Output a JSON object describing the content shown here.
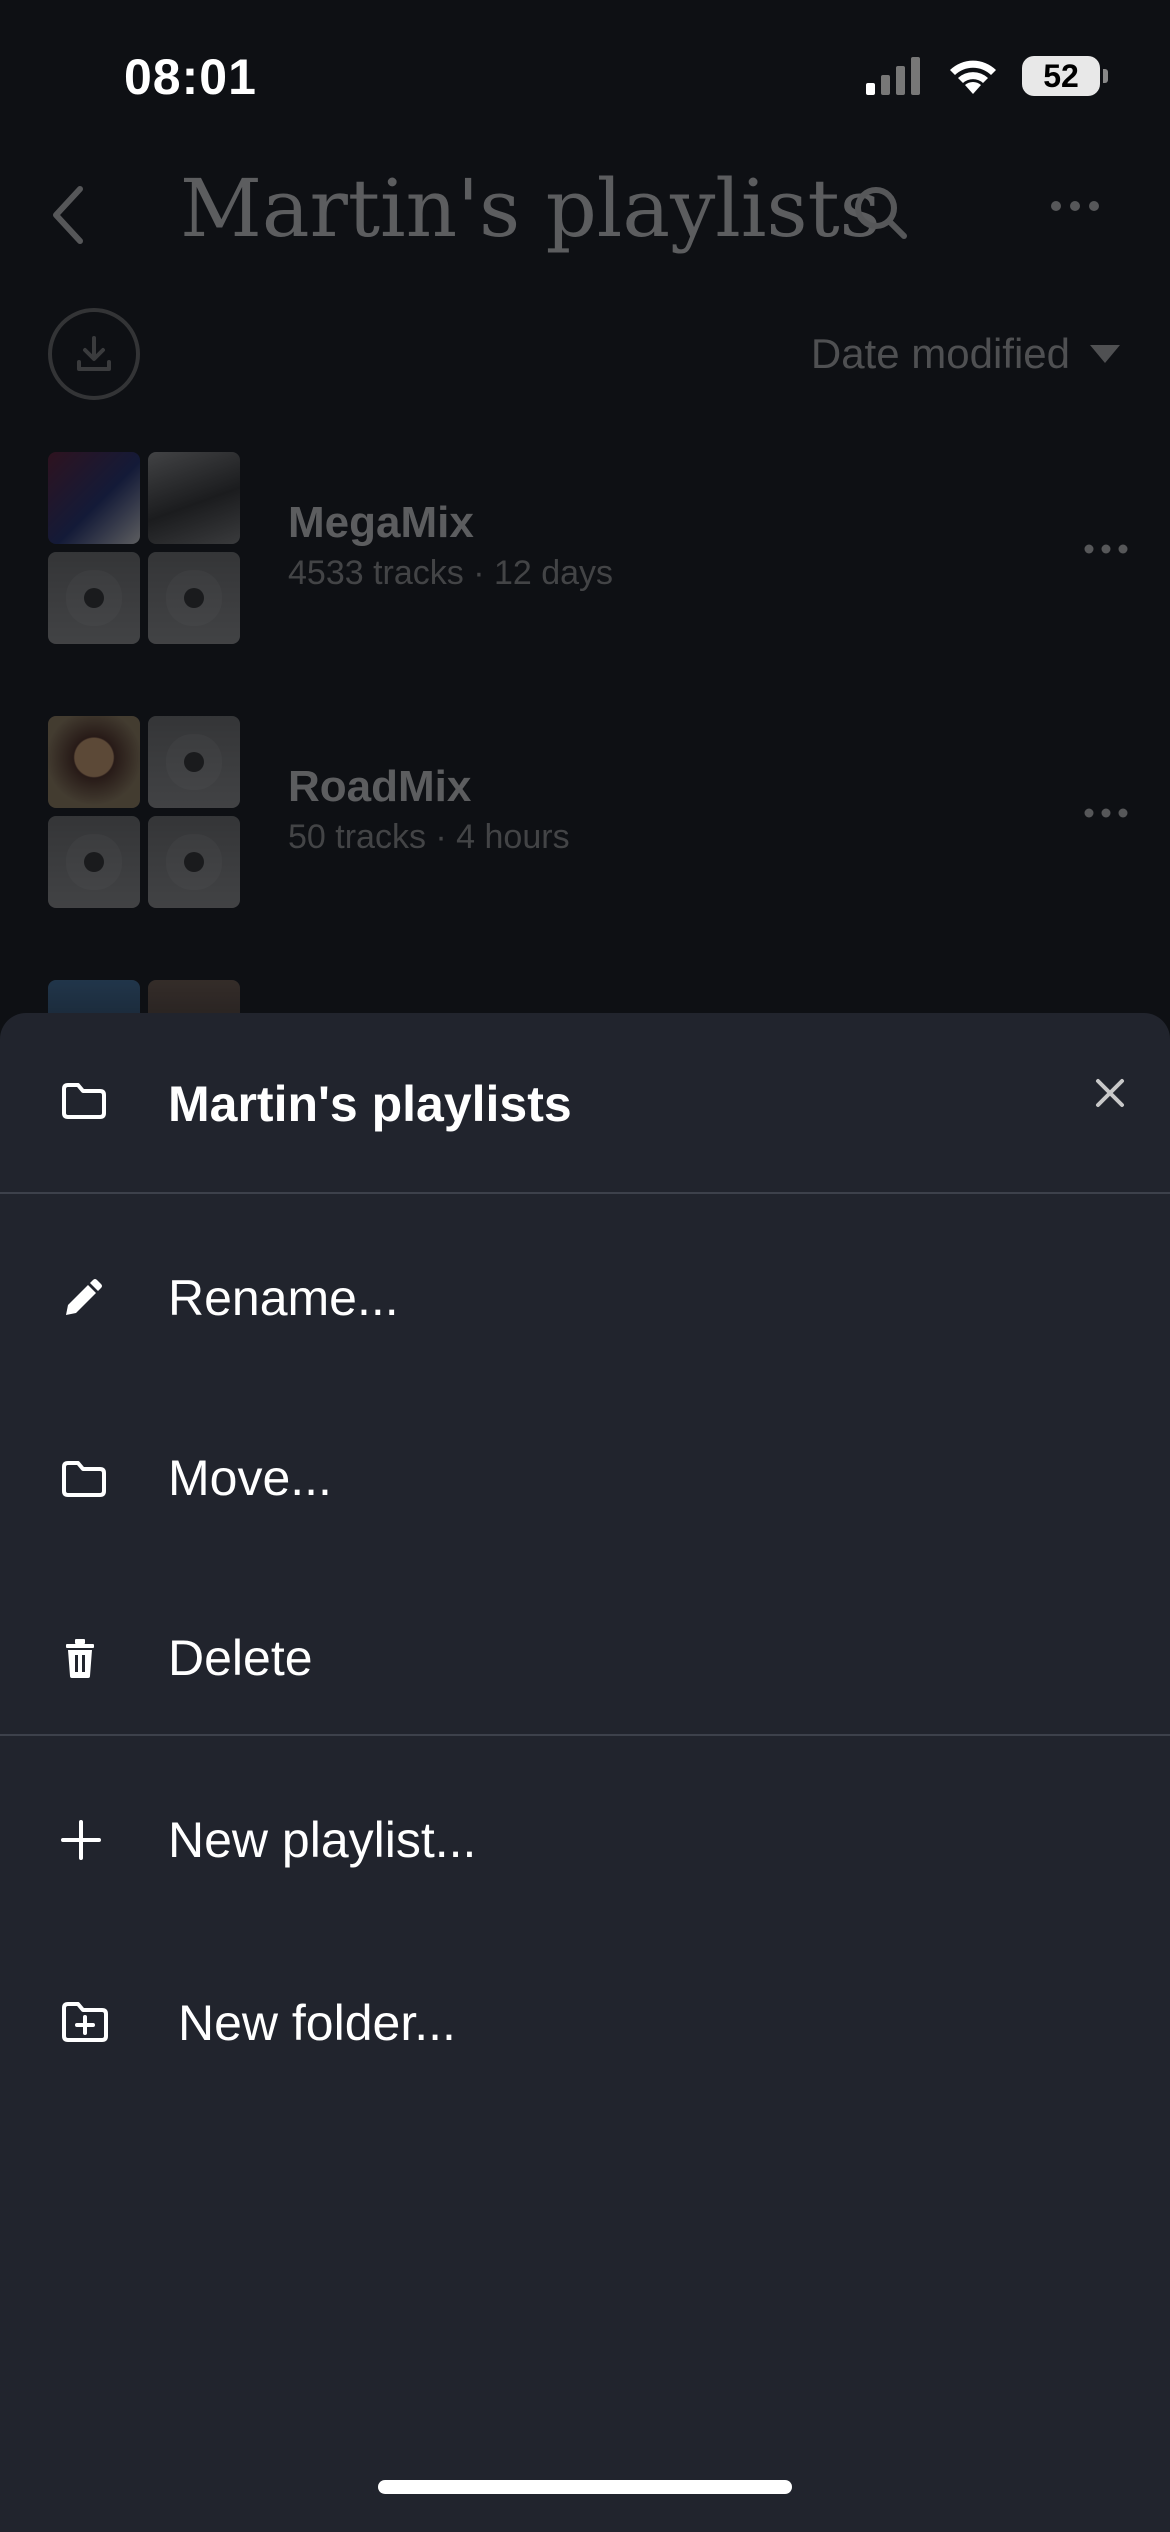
{
  "status_bar": {
    "time": "08:01",
    "battery": "52"
  },
  "header": {
    "title": "Martin's playlists"
  },
  "sort": {
    "label": "Date modified"
  },
  "playlists": [
    {
      "name": "MegaMix",
      "meta": "4533 tracks · 12 days"
    },
    {
      "name": "RoadMix",
      "meta": "50 tracks · 4 hours"
    }
  ],
  "sheet": {
    "title": "Martin's playlists",
    "items": [
      {
        "label": "Rename...",
        "icon": "pencil-icon"
      },
      {
        "label": "Move...",
        "icon": "folder-icon"
      },
      {
        "label": "Delete",
        "icon": "trash-icon"
      },
      {
        "label": "New playlist...",
        "icon": "plus-icon"
      },
      {
        "label": "New folder...",
        "icon": "folder-plus-icon"
      }
    ]
  }
}
